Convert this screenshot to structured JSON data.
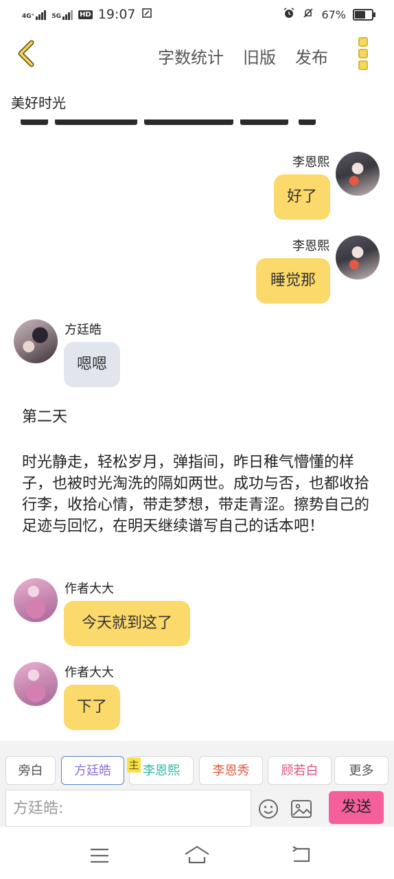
{
  "status": {
    "net1": "4G⁺",
    "net2": "5G",
    "hd": "HD",
    "time": "19:07",
    "battery": "67%",
    "battery_level": 0.67
  },
  "toolbar": {
    "items": [
      "字数统计",
      "旧版",
      "发布"
    ]
  },
  "story": {
    "title": "美好时光"
  },
  "messages": [
    {
      "name": "李恩熙",
      "text": "好了"
    },
    {
      "name": "李恩熙",
      "text": "睡觉那"
    },
    {
      "name": "方廷皓",
      "text": "嗯嗯"
    },
    {
      "name": "作者大大",
      "text": "今天就到这了"
    },
    {
      "name": "作者大大",
      "text": "下了"
    }
  ],
  "narration": {
    "day": "第二天",
    "paragraph": "时光静走，轻松岁月，弹指间，昨日稚气懵懂的样子，也被时光淘洗的隔如两世。成功与否，也都收拾行李，收拾心情，带走梦想，带走青涩。擦势自己的足迹与回忆，在明天继续谱写自己的话本吧！"
  },
  "roles": {
    "items": [
      {
        "label": "旁白",
        "color": "#555555"
      },
      {
        "label": "方廷皓",
        "color": "#8a6fd0"
      },
      {
        "label": "李恩熙",
        "color": "#2bb5a8"
      },
      {
        "label": "李恩秀",
        "color": "#e05a3a"
      },
      {
        "label": "顾若白",
        "color": "#e0507a"
      },
      {
        "label": "更多",
        "color": "#555555"
      }
    ],
    "host_badge": "主"
  },
  "composer": {
    "placeholder": "方廷皓:",
    "send_label": "发送"
  },
  "colors": {
    "accent": "#f6d860",
    "bubble_yellow": "#fbd96a",
    "bubble_grey": "#e1e6ee",
    "send": "#f5609c",
    "selected_role_border": "#5b7fd4"
  }
}
